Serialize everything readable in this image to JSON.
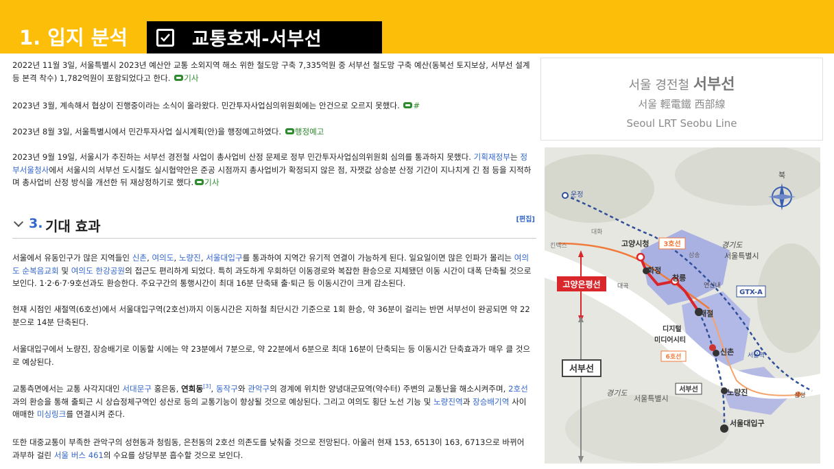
{
  "slide": {
    "title": "1. 입지 분석",
    "topic": "교통호재-서부선"
  },
  "history": [
    {
      "parts": [
        {
          "t": "2022년 11월 3일, 서울특별시 2023년 예산안 교통 소외지역 해소 위한 철도망 구축 7,335억원 중 서부선 철도망 구축 예산(동북선 토지보상, 서부선 설계 등 본격 착수) 1,782억원이 포함되었다고 한다. "
        },
        {
          "icon": true
        },
        {
          "t": "기사",
          "c": "ext"
        }
      ]
    },
    {
      "parts": [
        {
          "t": "2023년 3월, 계속해서 협상이 진행중이라는 소식이 올라왔다. 민간투자사업심의위원회에는 안건으로 오르지 못했다. "
        },
        {
          "icon": true
        },
        {
          "t": "#",
          "c": "ext"
        }
      ]
    },
    {
      "parts": [
        {
          "t": "2023년 8월 3일, 서울특별시에서 민간투자사업 실시계획(안)을 행정예고하였다. "
        },
        {
          "icon": true
        },
        {
          "t": "행정예고",
          "c": "ext"
        }
      ]
    },
    {
      "parts": [
        {
          "t": "2023년 9월 19일, 서울시가 추진하는 서부선 경전철 사업이 총사업비 산정 문제로 정부 민간투자사업심의위원회 심의를 통과하지 못했다. "
        },
        {
          "t": "기획재정부",
          "c": "lnk"
        },
        {
          "t": "는 "
        },
        {
          "t": "정부서울청사",
          "c": "lnk"
        },
        {
          "t": "에서 서울시의 서부선 도시철도 실시협약안은 준공 시점까지 총사업비가 확정되지 않은 점, 자잿값 상승분 산정 기간이 지나치게 긴 점 등을 지적하며 총사업비 산정 방식을 개선한 뒤 재상정하기로 했다."
        },
        {
          "icon": true
        },
        {
          "t": "기사",
          "c": "ext"
        }
      ]
    }
  ],
  "section": {
    "number": "3.",
    "title": "기대 효과",
    "edit": "[편집]"
  },
  "effects": [
    {
      "parts": [
        {
          "t": "서울에서 유동인구가 많은 지역들인 "
        },
        {
          "t": "신촌",
          "c": "lnk"
        },
        {
          "t": ", "
        },
        {
          "t": "여의도",
          "c": "lnk"
        },
        {
          "t": ", "
        },
        {
          "t": "노량진",
          "c": "lnk"
        },
        {
          "t": ", "
        },
        {
          "t": "서울대입구",
          "c": "lnk"
        },
        {
          "t": "를 통과하여 지역간 유기적 연결이 가능하게 된다. 일요일이면 많은 인파가 몰리는 "
        },
        {
          "t": "여의도 순복음교회",
          "c": "lnk"
        },
        {
          "t": " 및 "
        },
        {
          "t": "여의도 한강공원",
          "c": "lnk"
        },
        {
          "t": "의 접근도 편리하게 되었다. 특히 과도하게 우회하던 이동경로와 복잡한 환승으로 지체됐던 이동 시간이 대폭 단축될 것으로 보인다. 1·2·6·7·9호선과도 환승한다. 주요구간의 통행시간이 최대 16분 단축돼 출·퇴근 등 이동시간이 크게 감소된다."
        }
      ]
    },
    {
      "parts": [
        {
          "t": "현재 시점인 새절역(6호선)에서 서울대입구역(2호선)까지 이동시간은 지하철 최단시간 기준으로 1회 환승, 약 36분이 걸리는 반면 서부선이 완공되면 약 22분으로 14분 단축된다."
        }
      ]
    },
    {
      "parts": [
        {
          "t": "서울대입구에서 노량진, 장승배기로 이동할 시에는 약 23분에서 7분으로, 약 22분에서 6분으로 최대 16분이 단축되는 등 이동시간 단축효과가 매우 클 것으로 예상된다."
        }
      ]
    },
    {
      "parts": [
        {
          "t": "교통측면에서는 교통 사각지대인 "
        },
        {
          "t": "서대문구",
          "c": "lnk"
        },
        {
          "t": " 홍은동, "
        },
        {
          "t": "연희동",
          "b": true
        },
        {
          "t": "[3]",
          "sup": true
        },
        {
          "t": ", "
        },
        {
          "t": "동작구",
          "c": "lnk"
        },
        {
          "t": "와 "
        },
        {
          "t": "관악구",
          "c": "lnk"
        },
        {
          "t": "의 경계에 위치한 양녕대군묘역(약수터) 주변의 교통난을 해소시켜주며, "
        },
        {
          "t": "2호선",
          "c": "lnk"
        },
        {
          "t": "과의 환승을 통해 출퇴근 시 상습정체구역인 성산로 등의 교통기능이 향상될 것으로 예상된다. 그리고 여의도 횡단 노선 기능 및 "
        },
        {
          "t": "노량진역",
          "c": "lnk"
        },
        {
          "t": "과 "
        },
        {
          "t": "장승배기역",
          "c": "lnk"
        },
        {
          "t": " 사이 애매한 "
        },
        {
          "t": "미싱링크",
          "c": "lnk"
        },
        {
          "t": "를 연결시켜 준다."
        }
      ]
    },
    {
      "parts": [
        {
          "t": "또한 대중교통이 부족한 관악구의 성현동과 청림동, 은천동의 2호선 의존도를 낮춰줄 것으로 전망된다. 아울러 현재 153, 6513이 163, 6713으로 바뀌어 과부하 걸린 "
        },
        {
          "t": "서울 버스 461",
          "c": "lnk"
        },
        {
          "t": "의 수요를 상당부분 흡수할 것으로 보인다."
        }
      ]
    }
  ],
  "infobox": {
    "prefix": "서울 경전철",
    "name": "서부선",
    "hanja": "서울 輕電鐵 西部線",
    "english": "Seoul LRT Seobu Line"
  },
  "map": {
    "north": "북",
    "labels": {
      "ungjeong": "운정",
      "daehwa": "대화",
      "kintex": "킨텍스",
      "goyang": "고양시청",
      "line3": "3호선",
      "hwajeong": "화정",
      "daegok": "대곡",
      "samsong": "삼송",
      "changneung": "창릉",
      "yeonsinnae": "연신내",
      "gyeonggi": "경기도",
      "seoul": "서울특별시",
      "gtx": "GTX-A",
      "saejeol": "새절",
      "dmc1": "디지털",
      "dmc2": "미디어시티",
      "line6": "6호선",
      "sinchon": "신촌",
      "seoulstn": "서울역",
      "goyangeun": "고양은평선",
      "seobu": "서부선",
      "seobu2": "서부선",
      "noryangjin": "노량진",
      "snu": "서울대입구",
      "gyeonggi2": "경기도",
      "seoul2": "서울특별시",
      "samseong": "삼성"
    },
    "colors": {
      "red": "#d9262b",
      "orange": "#f07a3a",
      "blue": "#2f4f9a",
      "gtx": "#2f4f9a",
      "land": "#e8e9e3",
      "urban": "#a7aee0",
      "river": "#ffffff"
    }
  }
}
